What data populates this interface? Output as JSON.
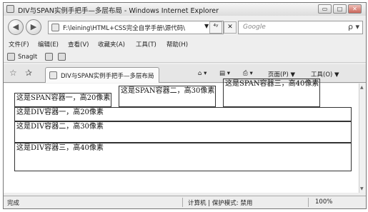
{
  "window": {
    "title": "DIV与SPAN实例手把手—多层布局 - Windows Internet Explorer",
    "buttons": {
      "minimize": "▭",
      "maximize": "□",
      "close": "✕"
    }
  },
  "nav": {
    "back_icon": "◀",
    "forward_icon": "▶",
    "address": "F:\\leining\\HTML+CSS完全自学手册\\源代码\\",
    "address_dropdown": "▼",
    "refresh_label": "⁴ʸ",
    "stop_label": "✕",
    "search_placeholder": "Google",
    "search_icon": "ρ ▾"
  },
  "menu": [
    "文件(F)",
    "编辑(E)",
    "查看(V)",
    "收藏夹(A)",
    "工具(T)",
    "帮助(H)"
  ],
  "snagit": {
    "label": "SnagIt"
  },
  "tabs": {
    "favorites_icon": "☆",
    "add_favorites_icon": "✰",
    "active_tab": "DIV与SPAN实例手把手—多层布局",
    "home_label": "⌂ ▾",
    "feeds_label": "▤ ▾",
    "print_label": "⎙ ▾",
    "page_menu": "页面(P) ▼",
    "tools_menu": "工具(O) ▼"
  },
  "content": {
    "span1": "这是SPAN容器一，高20像素",
    "span2": "这是SPAN容器二，高30像素",
    "span3": "这是SPAN容器三，高40像素",
    "div1": "这是DIV容器一，高20像素",
    "div2": "这是DIV容器二，高30像素",
    "div3": "这是DIV容器三，高40像素"
  },
  "status": {
    "left": "完成",
    "zone": "计算机 | 保护模式: 禁用",
    "zoom": "100%"
  }
}
